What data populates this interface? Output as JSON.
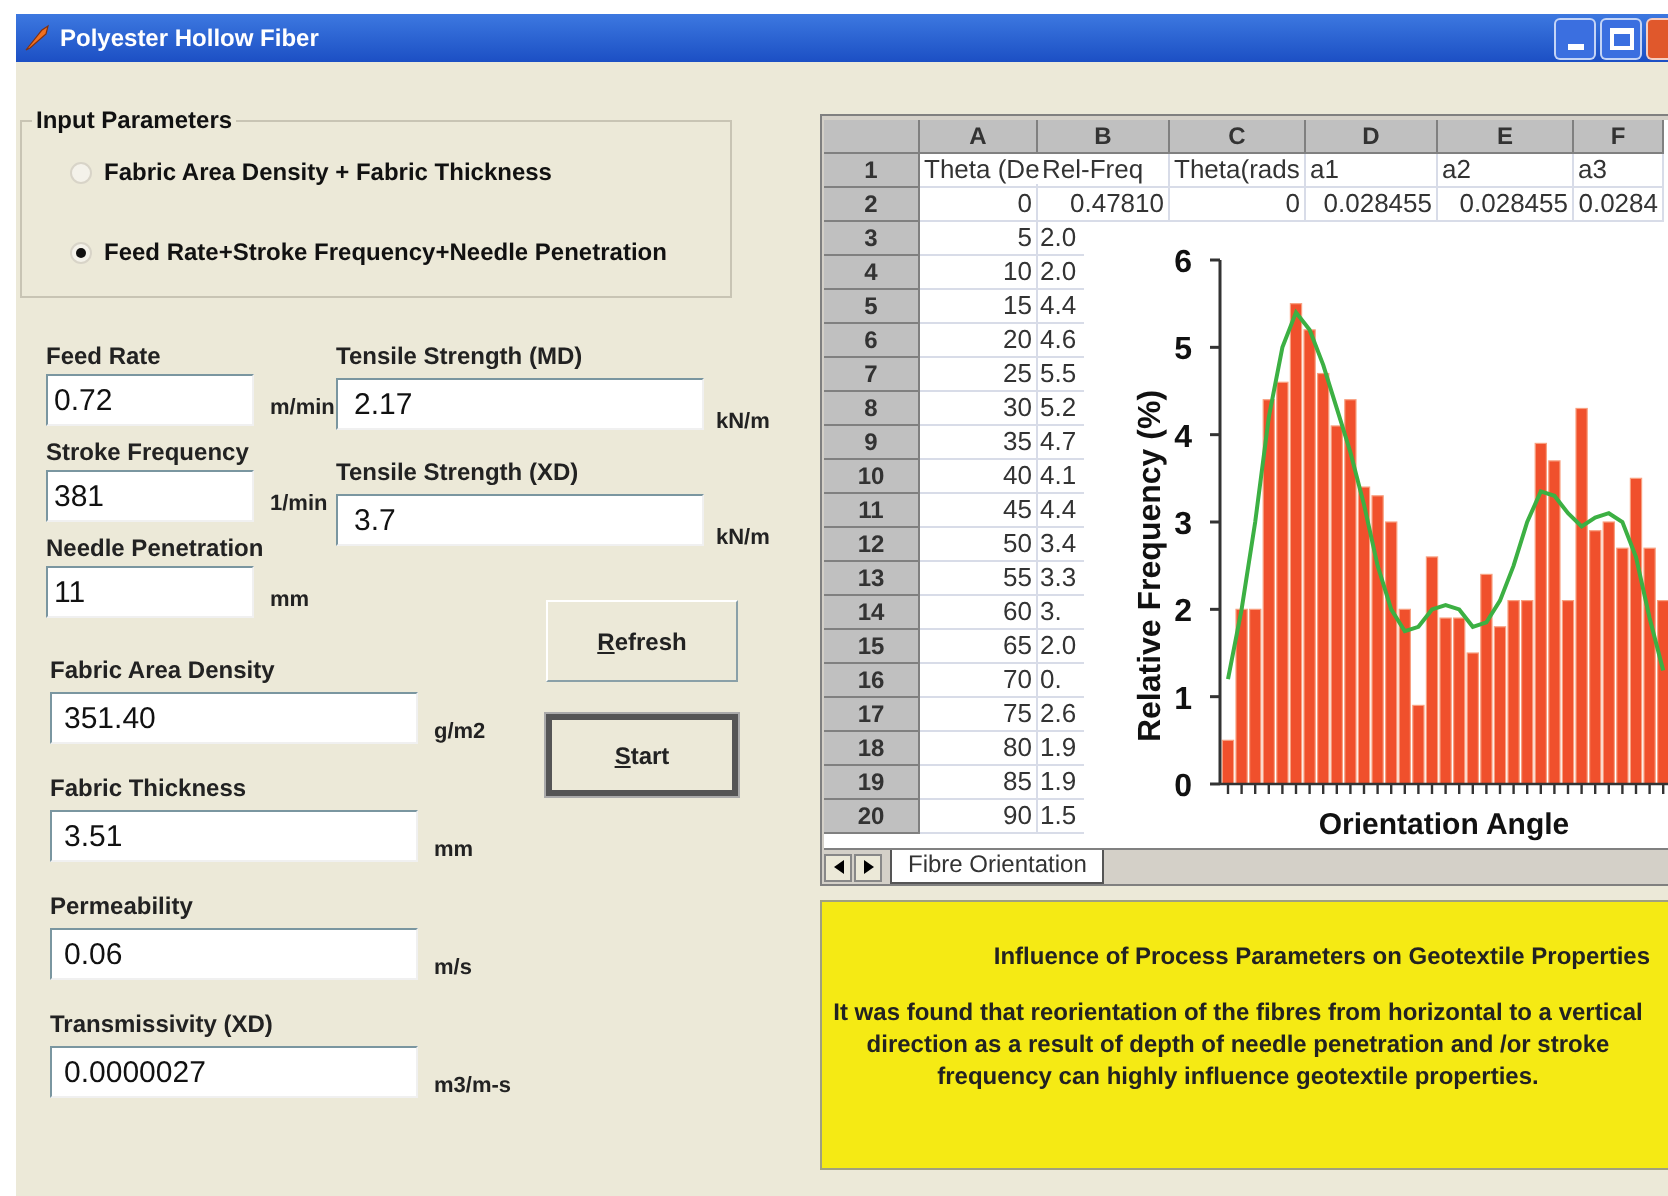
{
  "window": {
    "title": "Polyester Hollow Fiber"
  },
  "input_parameters": {
    "title": "Input Parameters",
    "options": [
      {
        "label": "Fabric Area Density + Fabric Thickness",
        "selected": false
      },
      {
        "label": "Feed Rate+Stroke Frequency+Needle Penetration",
        "selected": true
      }
    ]
  },
  "process_fields": [
    {
      "label": "Feed Rate",
      "value": "0.72",
      "unit": "m/min"
    },
    {
      "label": "Stroke Frequency",
      "value": "381",
      "unit": "1/min"
    },
    {
      "label": "Needle Penetration",
      "value": "11",
      "unit": "mm"
    }
  ],
  "tensile_fields": [
    {
      "label": "Tensile Strength (MD)",
      "value": "2.17",
      "unit": "kN/m"
    },
    {
      "label": "Tensile Strength (XD)",
      "value": "3.7",
      "unit": "kN/m"
    }
  ],
  "property_fields": [
    {
      "label": "Fabric Area Density",
      "value": "351.40",
      "unit": "g/m2"
    },
    {
      "label": "Fabric Thickness",
      "value": "3.51",
      "unit": "mm"
    },
    {
      "label": "Permeability",
      "value": "0.06",
      "unit": "m/s"
    },
    {
      "label": "Transmissivity (XD)",
      "value": "0.0000027",
      "unit": "m3/m-s"
    }
  ],
  "buttons": [
    {
      "label": "Refresh",
      "default": false
    },
    {
      "label": "Start",
      "default": true
    }
  ],
  "spreadsheet": {
    "columns": [
      "A",
      "B",
      "C",
      "D",
      "E",
      "F"
    ],
    "rows": [
      {
        "header": "1",
        "cells": [
          "Theta (De",
          "Rel-Freq",
          "Theta(rads",
          "a1",
          "a2",
          "a3"
        ]
      },
      {
        "header": "2",
        "cells": [
          "0",
          "0.47810",
          "0",
          "0.028455",
          "0.028455",
          "0.0284"
        ]
      },
      {
        "header": "3",
        "cells": [
          "5",
          "2.0"
        ]
      },
      {
        "header": "4",
        "cells": [
          "10",
          "2.0"
        ]
      },
      {
        "header": "5",
        "cells": [
          "15",
          "4.4"
        ]
      },
      {
        "header": "6",
        "cells": [
          "20",
          "4.6"
        ]
      },
      {
        "header": "7",
        "cells": [
          "25",
          "5.5"
        ]
      },
      {
        "header": "8",
        "cells": [
          "30",
          "5.2"
        ]
      },
      {
        "header": "9",
        "cells": [
          "35",
          "4.7"
        ]
      },
      {
        "header": "10",
        "cells": [
          "40",
          "4.1"
        ]
      },
      {
        "header": "11",
        "cells": [
          "45",
          "4.4"
        ]
      },
      {
        "header": "12",
        "cells": [
          "50",
          "3.4"
        ]
      },
      {
        "header": "13",
        "cells": [
          "55",
          "3.3"
        ]
      },
      {
        "header": "14",
        "cells": [
          "60",
          "3."
        ]
      },
      {
        "header": "15",
        "cells": [
          "65",
          "2.0"
        ]
      },
      {
        "header": "16",
        "cells": [
          "70",
          "0."
        ]
      },
      {
        "header": "17",
        "cells": [
          "75",
          "2.6"
        ]
      },
      {
        "header": "18",
        "cells": [
          "80",
          "1.9"
        ]
      },
      {
        "header": "19",
        "cells": [
          "85",
          "1.9"
        ]
      },
      {
        "header": "20",
        "cells": [
          "90",
          "1.5"
        ]
      }
    ],
    "sheet_tabs": [
      {
        "label": "Fibre Orientation",
        "selected": true
      }
    ],
    "chart": {
      "chart_data": {
        "type": "bar",
        "xlabel": "Orientation Angle",
        "ylabel": "Relative Frequency (%)",
        "ylim": [
          0,
          6
        ],
        "yticks": [
          0,
          1,
          2,
          3,
          4,
          5,
          6
        ],
        "series": [
          {
            "type": "bar",
            "color": "#f0502c",
            "values": [
              0.5,
              2.0,
              2.0,
              4.4,
              4.6,
              5.5,
              5.2,
              4.7,
              4.1,
              4.4,
              3.4,
              3.3,
              3.0,
              2.0,
              0.9,
              2.6,
              1.9,
              1.9,
              1.5,
              2.4,
              1.8,
              2.1,
              2.1,
              3.9,
              3.7,
              2.1,
              4.3,
              2.9,
              3.0,
              2.7,
              3.5,
              2.7,
              2.1
            ]
          },
          {
            "type": "line",
            "color": "#3cb043",
            "values": [
              1.2,
              2.0,
              3.0,
              4.2,
              5.0,
              5.4,
              5.2,
              4.8,
              4.3,
              3.8,
              3.2,
              2.5,
              2.0,
              1.75,
              1.8,
              2.0,
              2.05,
              2.0,
              1.8,
              1.85,
              2.1,
              2.5,
              3.0,
              3.35,
              3.3,
              3.1,
              2.95,
              3.05,
              3.1,
              3.0,
              2.6,
              1.9,
              1.3
            ]
          }
        ]
      }
    }
  },
  "info_panel": {
    "title": "Influence of Process Parameters on Geotextile Properties",
    "text": "It was found that reorientation of the fibres from horizontal to a vertical direction as a result of depth of needle penetration and /or stroke frequency can highly influence geotextile properties."
  }
}
